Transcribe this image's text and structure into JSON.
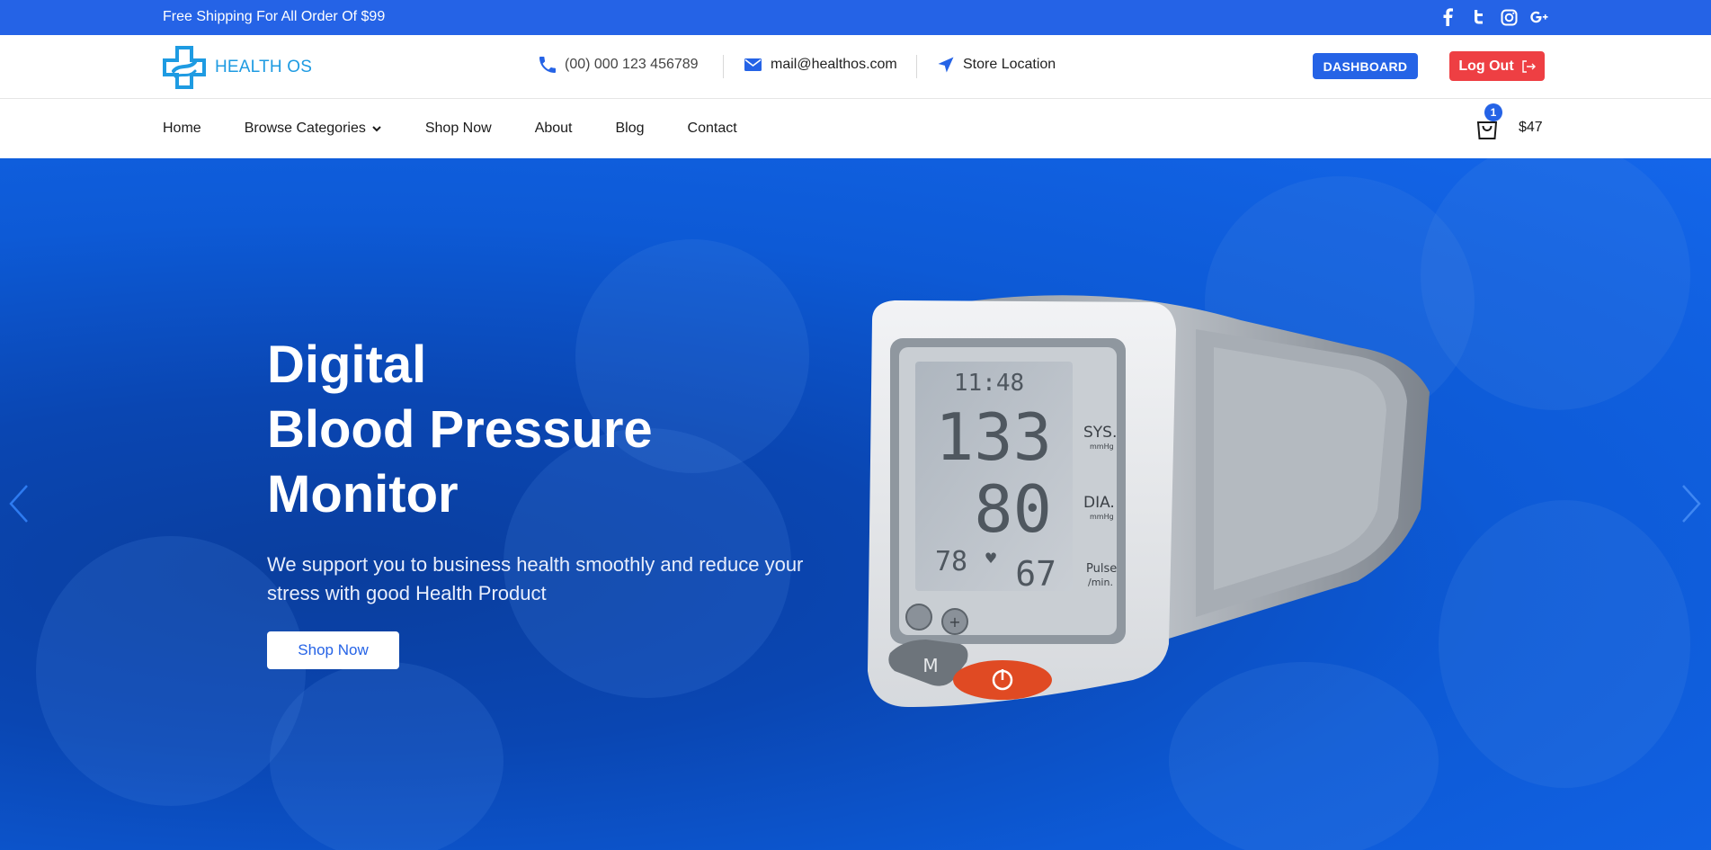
{
  "topbar": {
    "promo": "Free Shipping For All Order Of $99",
    "social_icons": [
      "facebook-icon",
      "twitter-icon",
      "instagram-icon",
      "google-plus-icon"
    ]
  },
  "header": {
    "logo_text": "HEALTH OS",
    "phone": "(00) 000 123 456789",
    "email": "mail@healthos.com",
    "store_location": "Store Location",
    "dashboard_label": "DASHBOARD",
    "logout_label": "Log Out"
  },
  "nav": {
    "items": [
      "Home",
      "Browse Categories",
      "Shop Now",
      "About",
      "Blog",
      "Contact"
    ],
    "cart_count": "1",
    "cart_total": "$47"
  },
  "hero": {
    "title_line1": "Digital",
    "title_line2": "Blood Pressure",
    "title_line3": "Monitor",
    "subtitle": "We support you to business health smoothly and reduce your stress with good Health Product",
    "button_label": "Shop Now",
    "device": {
      "time": "11:48",
      "sys": "133",
      "dia": "80",
      "pulse_left": "78",
      "pulse": "67",
      "sys_label": "SYS.",
      "dia_label": "DIA.",
      "pulse_label": "Pulse",
      "unit": "mmHg",
      "min_label": "/min.",
      "m_label": "M"
    }
  },
  "colors": {
    "primary": "#2563e6",
    "logout": "#ee3f43",
    "logo": "#1e9be2"
  }
}
